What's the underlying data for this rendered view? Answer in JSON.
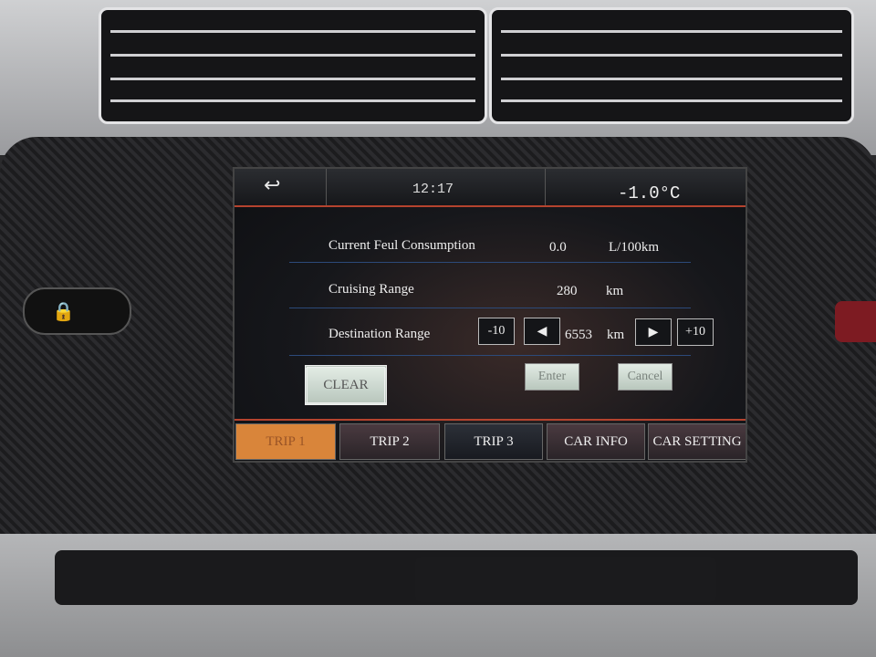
{
  "header": {
    "back_icon": "back-arrow-icon",
    "time": "12:17",
    "temperature": "-1.0°C"
  },
  "rows": [
    {
      "label": "Current Feul Consumption",
      "value": "0.0",
      "unit": "L/100km"
    },
    {
      "label": "Cruising Range",
      "value": "280",
      "unit": "km"
    },
    {
      "label": "Destination Range",
      "value": "6553",
      "unit": "km"
    }
  ],
  "controls": {
    "minus10": "-10",
    "plus10": "+10",
    "decrease_icon": "triangle-left-icon",
    "increase_icon": "triangle-right-icon",
    "clear": "CLEAR",
    "enter": "Enter",
    "cancel": "Cancel"
  },
  "tabs": [
    {
      "label": "TRIP 1",
      "active": true
    },
    {
      "label": "TRIP 2"
    },
    {
      "label": "TRIP 3"
    },
    {
      "label": "CAR INFO"
    },
    {
      "label": "CAR SETTING"
    }
  ],
  "colors": {
    "accent": "#b5432e",
    "active_tab": "#d9853a"
  }
}
